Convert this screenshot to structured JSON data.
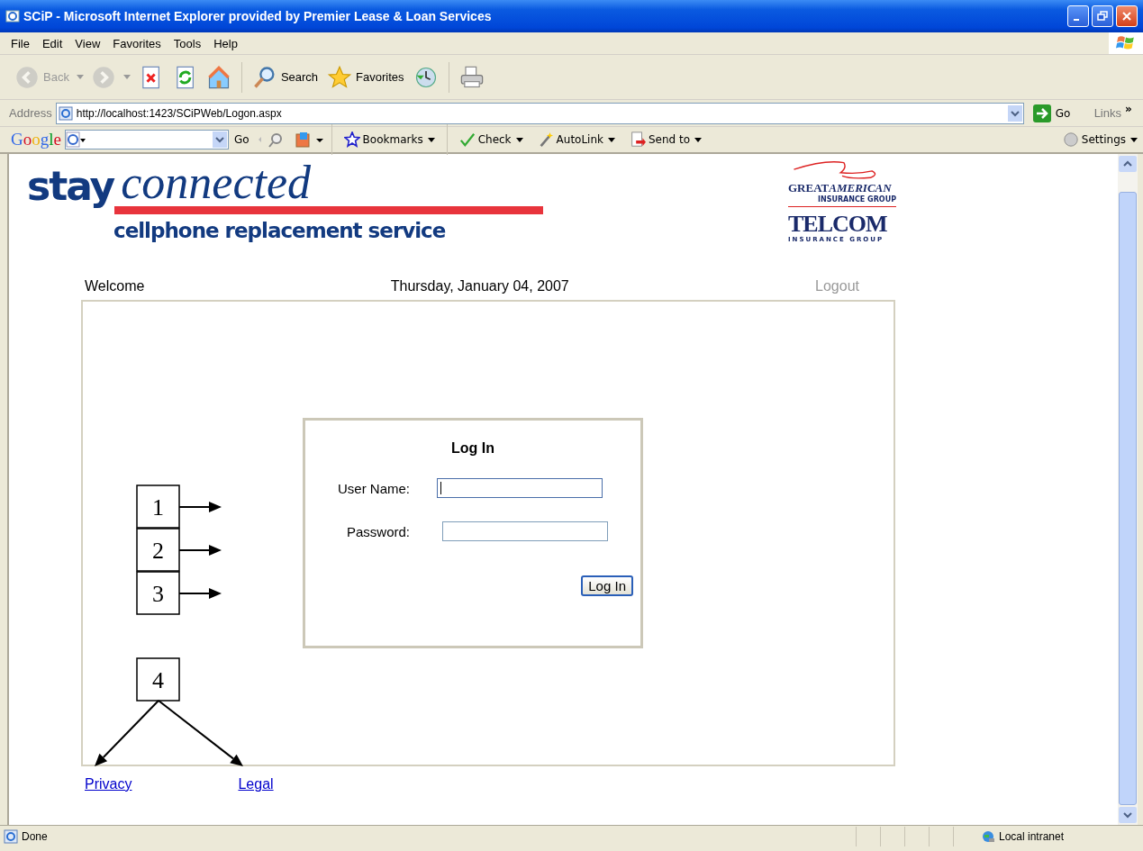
{
  "window": {
    "title": "SCiP - Microsoft Internet Explorer provided by Premier Lease & Loan Services"
  },
  "menu": [
    "File",
    "Edit",
    "View",
    "Favorites",
    "Tools",
    "Help"
  ],
  "toolbar": [
    {
      "kind": "back",
      "label": "Back",
      "disabled": true
    },
    {
      "kind": "forward",
      "disabled": true
    },
    {
      "kind": "stop",
      "disabled": false
    },
    {
      "kind": "refresh",
      "disabled": false
    },
    {
      "kind": "home",
      "disabled": false
    },
    {
      "kind": "search",
      "label": "Search",
      "disabled": false
    },
    {
      "kind": "favorites",
      "label": "Favorites",
      "disabled": false
    },
    {
      "kind": "history",
      "disabled": false
    },
    {
      "kind": "print",
      "disabled": false
    }
  ],
  "address_bar": {
    "label": "Address",
    "url": "http://localhost:1423/SCiPWeb/Logon.aspx",
    "go": "Go",
    "links": "Links",
    "more": "»"
  },
  "google_bar": {
    "logo": "Google",
    "go": "Go",
    "items": [
      {
        "kind": "bookmarks",
        "label": "Bookmarks"
      },
      {
        "kind": "check",
        "label": "Check"
      },
      {
        "kind": "autolink",
        "label": "AutoLink"
      },
      {
        "kind": "sendto",
        "label": "Send to"
      }
    ],
    "settings": "Settings"
  },
  "page": {
    "logo": {
      "stay": "stay",
      "connected": "connected",
      "tagline": "cellphone replacement service"
    },
    "partners": {
      "great": "GREAT",
      "american": "AMERICAN",
      "great_sub": "INSURANCE GROUP",
      "telcom": "TELCOM",
      "telcom_sub": "INSURANCE GROUP"
    },
    "welcome": "Welcome",
    "date": "Thursday, January 04, 2007",
    "logout": {
      "label": "Logout",
      "disabled": true
    },
    "login": {
      "title": "Log In",
      "fields": [
        {
          "label": "User Name:",
          "focused": true
        },
        {
          "label": "Password:",
          "focused": false
        }
      ],
      "button": "Log In"
    },
    "links": [
      "Privacy",
      "Legal"
    ],
    "callouts": [
      "1",
      "2",
      "3",
      "4"
    ]
  },
  "status_bar": {
    "text": "Done",
    "zone": "Local intranet"
  }
}
